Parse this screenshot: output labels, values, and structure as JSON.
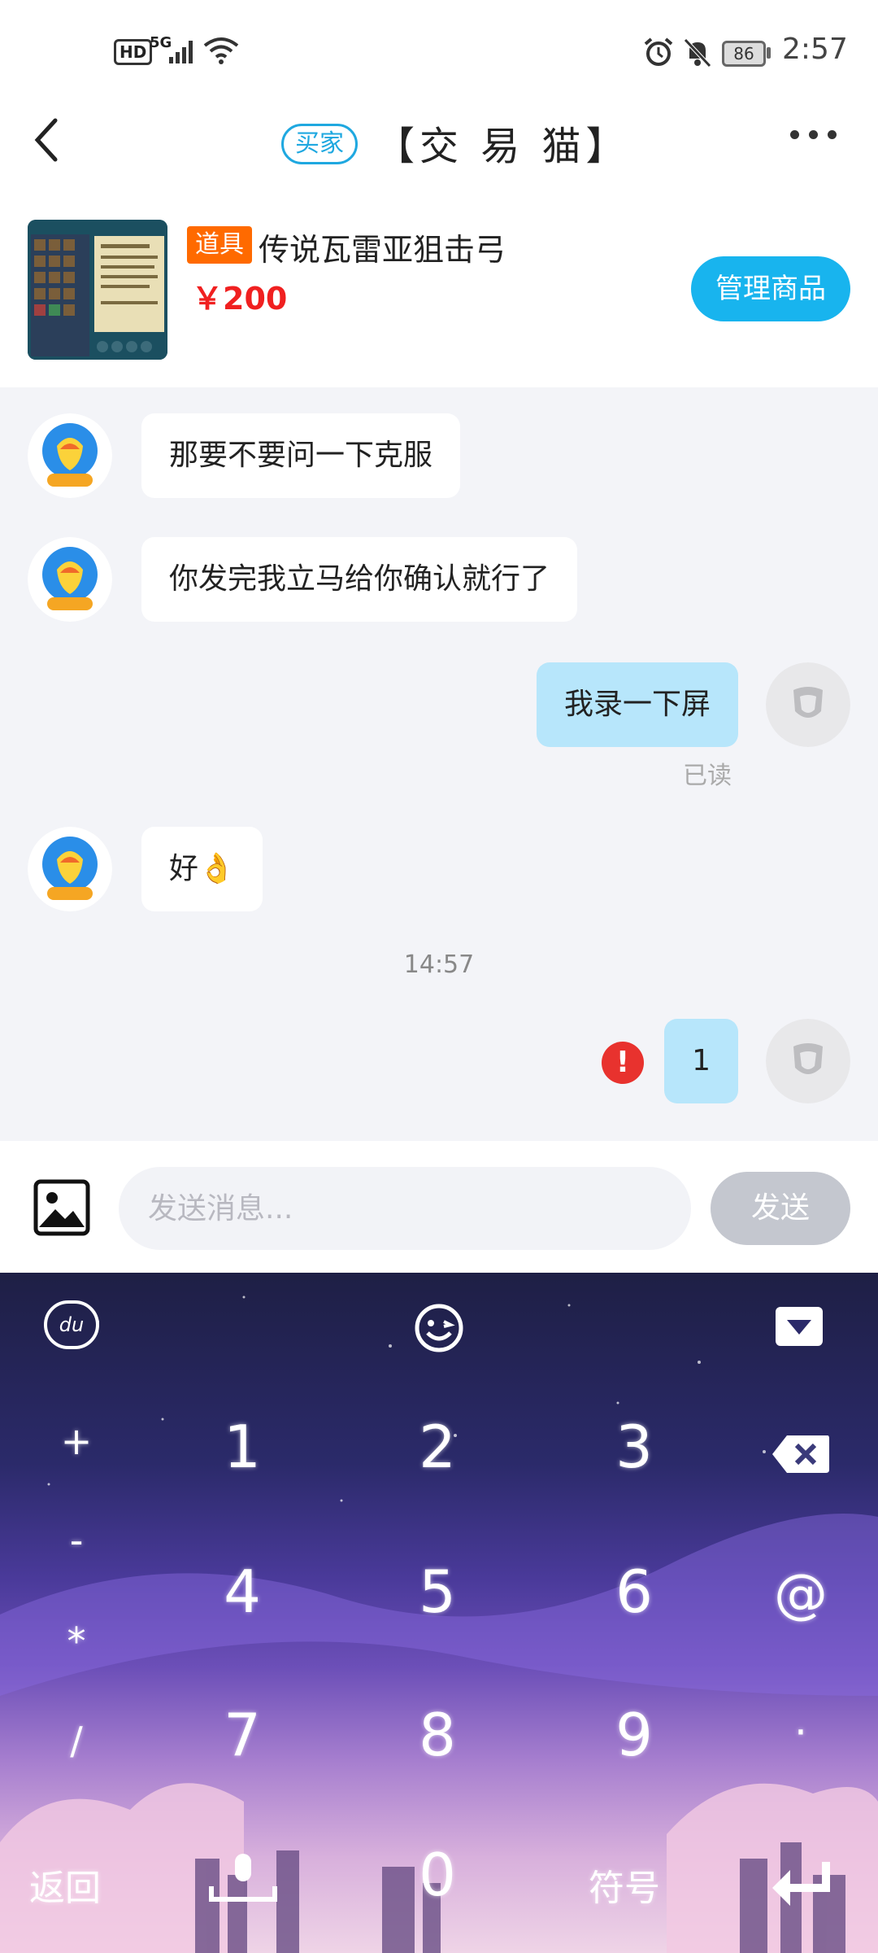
{
  "status_bar": {
    "hd": "HD",
    "network": "5G",
    "battery": "86",
    "time": "2:57"
  },
  "header": {
    "role_badge": "买家",
    "title": "【交 易 猫】"
  },
  "product": {
    "tag": "道具",
    "name": "传说瓦雷亚狙击弓",
    "price": "￥200",
    "manage_button": "管理商品"
  },
  "messages": [
    {
      "side": "in",
      "text": "那要不要问一下克服"
    },
    {
      "side": "in",
      "text": "你发完我立马给你确认就行了"
    },
    {
      "side": "out",
      "text": "我录一下屏",
      "status": "已读"
    },
    {
      "side": "in",
      "text": "好👌"
    },
    {
      "side": "out",
      "text": "1",
      "error": "!"
    }
  ],
  "timestamp": "14:57",
  "input": {
    "placeholder": "发送消息...",
    "send_label": "发送"
  },
  "keyboard": {
    "keys": {
      "k1": "1",
      "k2": "2",
      "k3": "3",
      "k4": "4",
      "k5": "5",
      "k6": "6",
      "k7": "7",
      "k8": "8",
      "k9": "9",
      "k0": "0",
      "plus": "+",
      "minus": "-",
      "star": "*",
      "slash": "/",
      "at": "@",
      "dot": "·",
      "back": "返回",
      "symbols": "符号"
    },
    "top_left": "du"
  },
  "colors": {
    "accent": "#18b4ee",
    "price": "#f02020",
    "tag": "#ff6a00",
    "out_bubble": "#b7e6fb",
    "chat_bg": "#f3f4f8"
  }
}
